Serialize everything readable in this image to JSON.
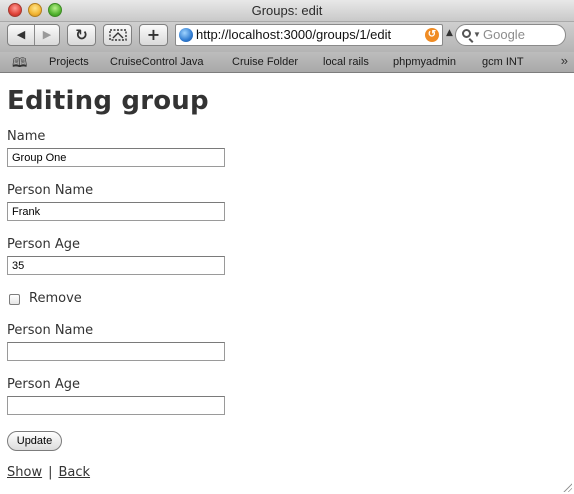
{
  "window": {
    "title": "Groups: edit"
  },
  "toolbar": {
    "back_icon": "back-arrow-icon",
    "forward_icon": "forward-arrow-icon",
    "reload_icon": "reload-icon",
    "snippet_icon": "snapback-icon",
    "add_icon": "add-bookmark-icon",
    "url": "http://localhost:3000/groups/1/edit",
    "search_placeholder": "Google"
  },
  "bookmarks": [
    {
      "label": "Projects"
    },
    {
      "label": "CruiseControl Java"
    },
    {
      "label": "Cruise Folder"
    },
    {
      "label": "local rails"
    },
    {
      "label": "phpmyadmin"
    },
    {
      "label": "gcm INT"
    }
  ],
  "page": {
    "heading": "Editing group",
    "name_label": "Name",
    "name_value": "Group One",
    "person1": {
      "name_label": "Person Name",
      "name_value": "Frank",
      "age_label": "Person Age",
      "age_value": "35"
    },
    "remove_label": "Remove",
    "person2": {
      "name_label": "Person Name",
      "name_value": "",
      "age_label": "Person Age",
      "age_value": ""
    },
    "update_label": "Update",
    "show_link": "Show",
    "separator": "|",
    "back_link": "Back"
  },
  "colors": {
    "text": "#333333",
    "rss": "#f08c24"
  }
}
